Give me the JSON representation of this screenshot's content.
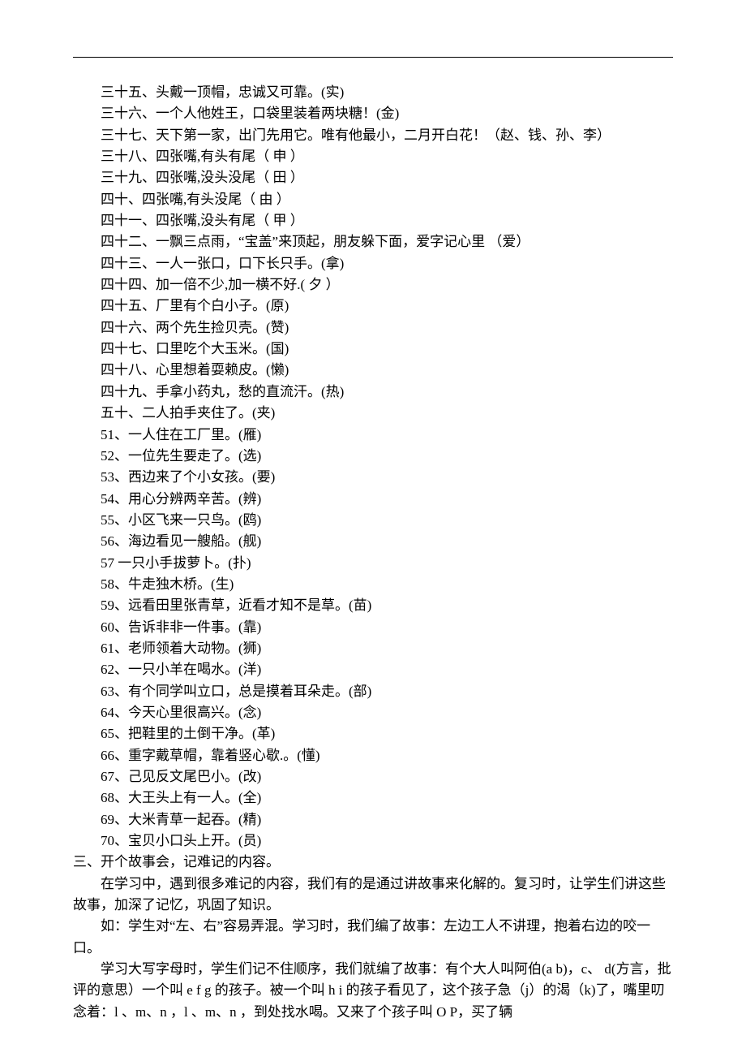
{
  "lines": [
    {
      "cls": "indent",
      "text": "三十五、头戴一顶帽，忠诚又可靠。(实)"
    },
    {
      "cls": "indent",
      "text": "三十六、一个人他姓王，口袋里装着两块糖！(金)"
    },
    {
      "cls": "indent",
      "text": "三十七、天下第一家，出门先用它。唯有他最小，二月开白花！（赵、钱、孙、李）"
    },
    {
      "cls": "indent",
      "text": "三十八、四张嘴,有头有尾（ 申 ）"
    },
    {
      "cls": "indent",
      "text": "三十九、四张嘴,没头没尾（ 田 ）"
    },
    {
      "cls": "indent",
      "text": "四十、四张嘴,有头没尾（ 由 ）"
    },
    {
      "cls": "indent",
      "text": "四十一、四张嘴,没头有尾（ 甲 ）"
    },
    {
      "cls": "indent",
      "text": "四十二、一飘三点雨，“宝盖”来顶起，朋友躲下面，爱字记心里  （爱）"
    },
    {
      "cls": "indent",
      "text": "四十三、一人一张口，口下长只手。(拿)"
    },
    {
      "cls": "indent",
      "text": "四十四、加一倍不少,加一横不好.( 夕 ）"
    },
    {
      "cls": "indent",
      "text": "四十五、厂里有个白小子。(原)"
    },
    {
      "cls": "indent",
      "text": "四十六、两个先生捡贝壳。(赞)"
    },
    {
      "cls": "indent",
      "text": "四十七、口里吃个大玉米。(国)"
    },
    {
      "cls": "indent",
      "text": "四十八、心里想着耍赖皮。(懒)"
    },
    {
      "cls": "indent",
      "text": "四十九、手拿小药丸，愁的直流汗。(热)"
    },
    {
      "cls": "indent",
      "text": "五十、二人拍手夹住了。(夹)"
    },
    {
      "cls": "indent",
      "text": "51、一人住在工厂里。(雁)"
    },
    {
      "cls": "indent",
      "text": "52、一位先生要走了。(选)"
    },
    {
      "cls": "indent",
      "text": "53、西边来了个小女孩。(要)"
    },
    {
      "cls": "indent",
      "text": "54、用心分辨两辛苦。(辨)"
    },
    {
      "cls": "indent",
      "text": "55、小区飞来一只鸟。(鸥)"
    },
    {
      "cls": "indent",
      "text": "56、海边看见一艘船。(舰)"
    },
    {
      "cls": "indent",
      "text": "57 一只小手拔萝卜。(扑)"
    },
    {
      "cls": "indent",
      "text": "58、牛走独木桥。(生)"
    },
    {
      "cls": "indent",
      "text": "59、远看田里张青草，近看才知不是草。(苗)"
    },
    {
      "cls": "indent",
      "text": "60、告诉非非一件事。(靠)"
    },
    {
      "cls": "indent",
      "text": "61、老师领着大动物。(狮)"
    },
    {
      "cls": "indent",
      "text": "62、一只小羊在喝水。(洋)"
    },
    {
      "cls": "indent",
      "text": "63、有个同学叫立口，总是摸着耳朵走。(部)"
    },
    {
      "cls": "indent",
      "text": "64、今天心里很高兴。(念)"
    },
    {
      "cls": "indent",
      "text": "65、把鞋里的土倒干净。(革)"
    },
    {
      "cls": "indent",
      "text": "66、重字戴草帽，靠着竖心歇.。(懂)"
    },
    {
      "cls": "indent",
      "text": "67、己见反文尾巴小。(改)"
    },
    {
      "cls": "indent",
      "text": "68、大王头上有一人。(全)"
    },
    {
      "cls": "indent",
      "text": "69、大米青草一起吞。(精)"
    },
    {
      "cls": "indent",
      "text": "70、宝贝小口头上开。(员)"
    },
    {
      "cls": "section-head",
      "text": "三、开个故事会，记难记的内容。"
    },
    {
      "cls": "indent",
      "text": "在学习中，遇到很多难记的内容，我们有的是通过讲故事来化解的。复习时，让学生们讲这些故事，加深了记忆，巩固了知识。"
    },
    {
      "cls": "indent",
      "text": "如：学生对“左、右”容易弄混。学习时，我们编了故事：左边工人不讲理，抱着右边的咬一口。"
    },
    {
      "cls": "indent",
      "text": "学习大写字母时，学生们记不住顺序，我们就编了故事：有个大人叫阿伯(a b)，c、 d(方言，批评的意思）一个叫 e f g 的孩子。被一个叫 h i 的孩子看见了，这个孩子急（j）的渴（k)了，嘴里叨念着：l 、m、n ，l 、m、n ，到处找水喝。又来了个孩子叫 O P，买了辆"
    }
  ]
}
